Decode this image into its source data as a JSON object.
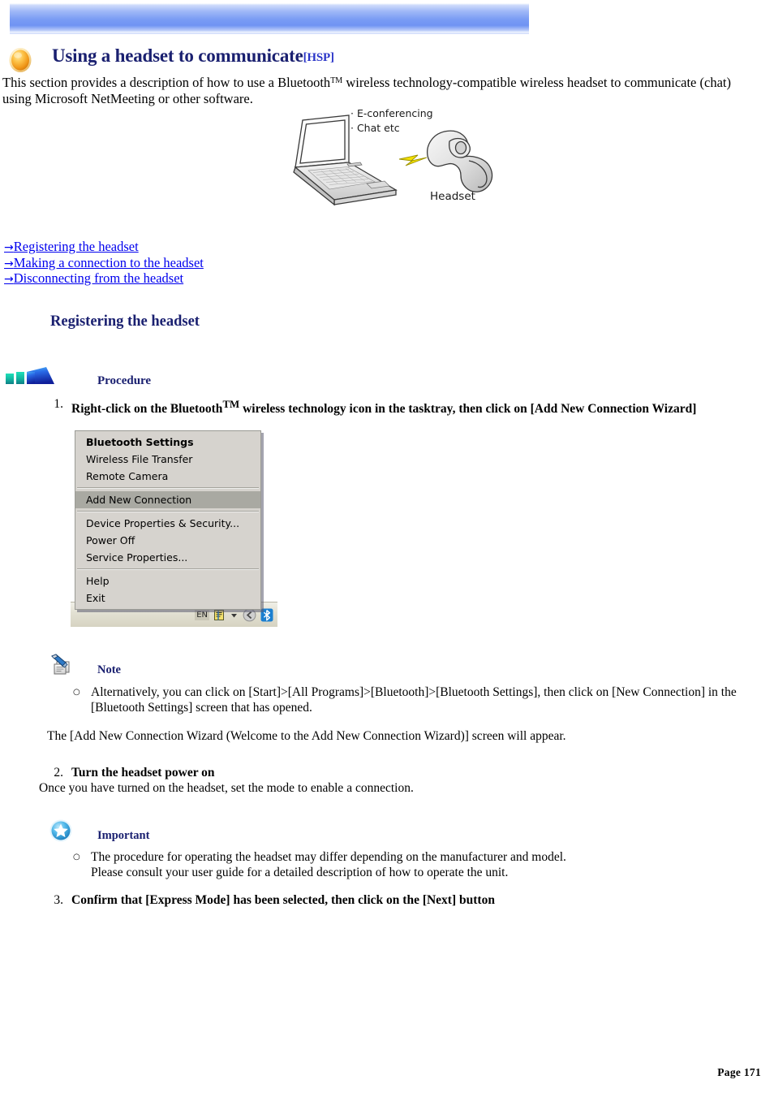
{
  "document": {
    "title": "Using a headset to communicate",
    "title_tag": "[HSP]",
    "intro_line1": "This section provides a description of how to use a Bluetooth",
    "intro_tm": "TM",
    "intro_line1b": " wireless technology-compatible wireless headset to communicate (chat) using",
    "intro_line2": "Microsoft NetMeeting or other software.",
    "page_number": "Page 171"
  },
  "figure": {
    "label_econferencing": "· E-conferencing",
    "label_chat": "· Chat etc",
    "label_headset": "Headset"
  },
  "links": [
    {
      "arrow": "→",
      "label": "Registering the headset"
    },
    {
      "arrow": "→",
      "label": "Making a connection to the headset"
    },
    {
      "arrow": "→",
      "label": "Disconnecting from the headset"
    }
  ],
  "section": {
    "heading": "Registering the headset",
    "procedure_label": "Procedure"
  },
  "steps": {
    "step1": {
      "num": "1.",
      "text_a": "Right-click on the Bluetooth",
      "tm": "TM",
      "text_b": " wireless technology icon in the tasktray, then click on [Add New Connection Wizard]"
    },
    "step2": {
      "num": "2.",
      "heading": "Turn the headset power on",
      "detail": "Once you have turned on the headset, set the mode to enable a connection."
    },
    "step3": {
      "num": "3.",
      "heading": "Confirm that [Express Mode] has been selected, then click on the [Next] button"
    }
  },
  "context_menu": {
    "items": [
      {
        "label": "Bluetooth Settings",
        "bold": true,
        "selected": false
      },
      {
        "label": "Wireless File Transfer",
        "bold": false,
        "selected": false
      },
      {
        "label": "Remote Camera",
        "bold": false,
        "selected": false
      },
      {
        "separator": true
      },
      {
        "label": "Add New Connection",
        "bold": false,
        "selected": true
      },
      {
        "separator": true
      },
      {
        "label": "Device Properties & Security...",
        "bold": false,
        "selected": false
      },
      {
        "label": "Power Off",
        "bold": false,
        "selected": false
      },
      {
        "label": "Service Properties...",
        "bold": false,
        "selected": false
      },
      {
        "separator": true
      },
      {
        "label": "Help",
        "bold": false,
        "selected": false
      },
      {
        "label": "Exit",
        "bold": false,
        "selected": false
      }
    ],
    "tray": {
      "language": "EN",
      "notepad_icon": "notepad-icon",
      "expand_icon": "tray-expand-arrow-icon",
      "prev_icon": "chevron-left-circle-icon",
      "bluetooth_icon": "bluetooth-icon"
    }
  },
  "note": {
    "icon": "note-pencil-icon",
    "label": "Note",
    "bullet1_line1": "Alternatively, you can click on [Start]>[All Programs]>[Bluetooth]>[Bluetooth Settings], then click on [New Connection] in the",
    "bullet1_line2": "[Bluetooth Settings] screen that has opened.",
    "after_text": "The [Add New Connection Wizard (Welcome to the Add New Connection Wizard)] screen will appear."
  },
  "important": {
    "icon": "star-circle-icon",
    "label": "Important",
    "bullet1_line1": "The procedure for operating the headset may differ depending on the manufacturer and model.",
    "bullet1_line2": "Please consult your user guide for a detailed description of how to operate the unit."
  },
  "colors": {
    "title_navy": "#1a2070",
    "link_blue": "#2a2ad8",
    "banner_blue": "#7a9cf4",
    "icon_orange": "#f5a623",
    "bluetooth_blue": "#1b9bd8"
  }
}
